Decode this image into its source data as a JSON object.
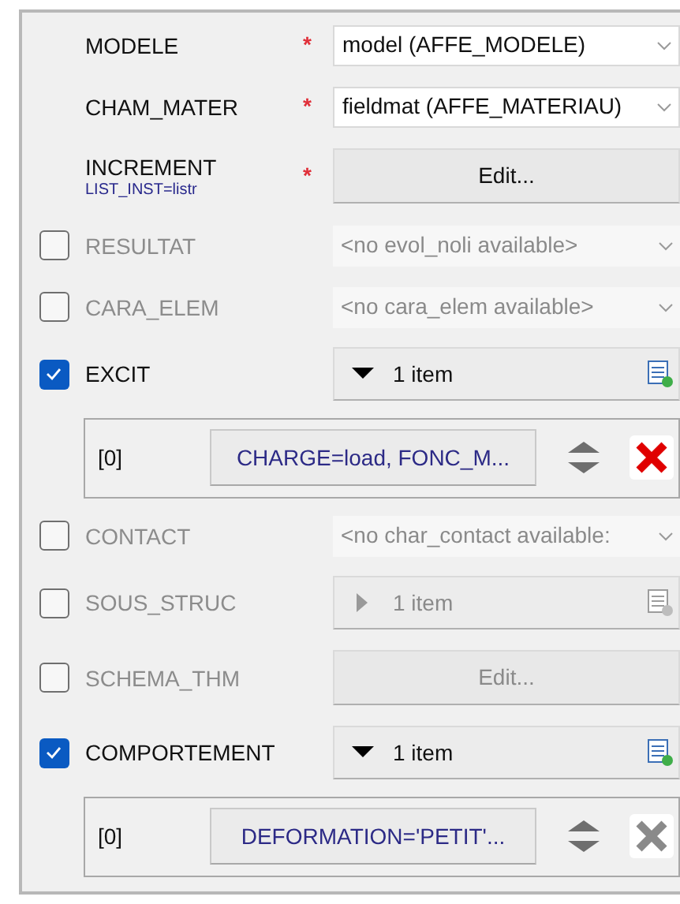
{
  "rows": [
    {
      "kind": "field",
      "required": true,
      "required_mark": "*",
      "label": "MODELE",
      "control": {
        "kind": "combo",
        "value": "model (AFFE_MODELE)",
        "disabled": false
      }
    },
    {
      "kind": "field",
      "required": true,
      "required_mark": "*",
      "label": "CHAM_MATER",
      "control": {
        "kind": "combo",
        "value": "fieldmat (AFFE_MATERIAU)",
        "disabled": false
      }
    },
    {
      "kind": "field",
      "required": true,
      "required_mark": "*",
      "label": "INCREMENT",
      "sublabel": "LIST_INST=listr",
      "control": {
        "kind": "button",
        "text": "Edit...",
        "disabled": false
      }
    },
    {
      "kind": "field",
      "required": false,
      "checked": false,
      "label": "RESULTAT",
      "control": {
        "kind": "combo",
        "value": "<no evol_noli available>",
        "disabled": true
      }
    },
    {
      "kind": "field",
      "required": false,
      "checked": false,
      "label": "CARA_ELEM",
      "control": {
        "kind": "combo",
        "value": "<no cara_elem available>",
        "disabled": true
      }
    },
    {
      "kind": "field",
      "required": false,
      "checked": true,
      "label": "EXCIT",
      "control": {
        "kind": "list",
        "text": "1 item",
        "expanded": true,
        "disabled": false
      }
    },
    {
      "kind": "item",
      "index": "[0]",
      "value": "CHARGE=load, FONC_M...",
      "delete_enabled": true
    },
    {
      "kind": "field",
      "required": false,
      "checked": false,
      "label": "CONTACT",
      "control": {
        "kind": "combo",
        "value": "<no char_contact available:",
        "disabled": true
      }
    },
    {
      "kind": "field",
      "required": false,
      "checked": false,
      "label": "SOUS_STRUC",
      "control": {
        "kind": "list",
        "text": "1 item",
        "expanded": false,
        "disabled": true
      }
    },
    {
      "kind": "field",
      "required": false,
      "checked": false,
      "label": "SCHEMA_THM",
      "control": {
        "kind": "button",
        "text": "Edit...",
        "disabled": true
      }
    },
    {
      "kind": "field",
      "required": false,
      "checked": true,
      "label": "COMPORTEMENT",
      "control": {
        "kind": "list",
        "text": "1 item",
        "expanded": true,
        "disabled": false
      }
    },
    {
      "kind": "item",
      "index": "[0]",
      "value": "DEFORMATION='PETIT'...",
      "delete_enabled": false
    }
  ]
}
